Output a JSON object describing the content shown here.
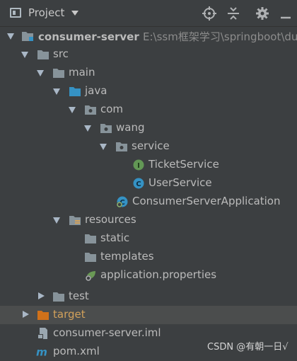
{
  "toolbar": {
    "title": "Project",
    "icons": [
      "project-view-icon",
      "dropdown-caret-icon",
      "locate-target-icon",
      "collapse-all-icon",
      "gear-icon",
      "minimize-icon"
    ]
  },
  "tree": [
    {
      "label": "consumer-server",
      "path": "E:\\ssm框架学习\\springboot\\dubb",
      "icon": "module-folder-icon",
      "state": "expanded"
    },
    {
      "label": "src",
      "icon": "folder-icon",
      "state": "expanded"
    },
    {
      "label": "main",
      "icon": "folder-icon",
      "state": "expanded"
    },
    {
      "label": "java",
      "icon": "source-folder-icon",
      "state": "expanded"
    },
    {
      "label": "com",
      "icon": "package-icon",
      "state": "expanded"
    },
    {
      "label": "wang",
      "icon": "package-icon",
      "state": "expanded"
    },
    {
      "label": "service",
      "icon": "package-icon",
      "state": "expanded"
    },
    {
      "label": "TicketService",
      "icon": "interface-icon",
      "badge": "I",
      "state": "leaf"
    },
    {
      "label": "UserService",
      "icon": "class-icon",
      "badge": "C",
      "state": "leaf"
    },
    {
      "label": "ConsumerServerApplication",
      "icon": "spring-boot-class-icon",
      "state": "leaf"
    },
    {
      "label": "resources",
      "icon": "resources-folder-icon",
      "state": "expanded"
    },
    {
      "label": "static",
      "icon": "folder-icon",
      "state": "leaf"
    },
    {
      "label": "templates",
      "icon": "folder-icon",
      "state": "leaf"
    },
    {
      "label": "application.properties",
      "icon": "spring-properties-icon",
      "state": "leaf"
    },
    {
      "label": "test",
      "icon": "folder-icon",
      "state": "collapsed"
    },
    {
      "label": "target",
      "icon": "excluded-folder-icon",
      "state": "collapsed"
    },
    {
      "label": "consumer-server.iml",
      "icon": "iml-file-icon",
      "state": "leaf"
    },
    {
      "label": "pom.xml",
      "icon": "maven-icon",
      "badge": "m",
      "state": "leaf"
    }
  ],
  "watermark": "CSDN @有朝一日√",
  "colors": {
    "background": "#3c3f41",
    "selected_row": "#4b4d4d",
    "text": "#bbbbbb",
    "excluded_text": "#d2a15b",
    "folder": "#87939a",
    "source_folder": "#3592c4",
    "interface_badge": "#629755",
    "class_badge": "#3592c4"
  }
}
